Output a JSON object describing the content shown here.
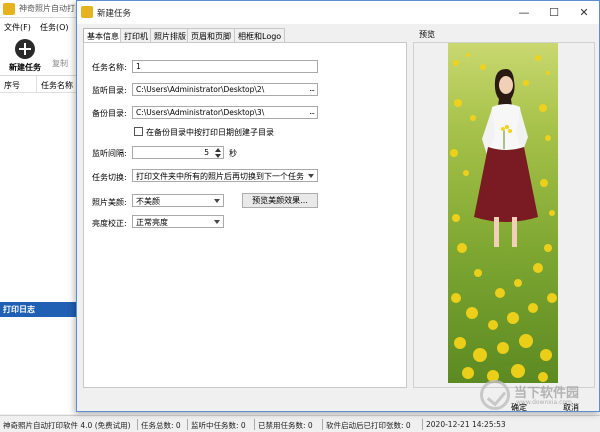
{
  "main_window": {
    "title": "神奇照片自动打",
    "menu": [
      "文件(F)",
      "任务(O)"
    ],
    "toolbar": {
      "new_task": "新建任务",
      "copy": "复制"
    },
    "list_headers": [
      "序号",
      "任务名称"
    ],
    "log_title": "打印日志"
  },
  "statusbar": {
    "items": [
      "神奇照片自动打印软件 4.0 (免费试用)",
      "任务总数: 0",
      "监听中任务数: 0",
      "已禁用任务数: 0",
      "软件启动后已打印张数: 0",
      "2020-12-21  14:25:53"
    ]
  },
  "dialog": {
    "title": "新建任务",
    "window_buttons": {
      "minimize": "—",
      "maximize": "☐",
      "close": "✕"
    },
    "tabs": [
      "基本信息",
      "打印机",
      "照片排版",
      "页眉和页脚",
      "相框和Logo"
    ],
    "active_tab": 0,
    "form": {
      "task_name_label": "任务名称:",
      "task_name_value": "1",
      "watch_dir_label": "监听目录:",
      "watch_dir_value": "C:\\Users\\Administrator\\Desktop\\2\\",
      "backup_dir_label": "备份目录:",
      "backup_dir_value": "C:\\Users\\Administrator\\Desktop\\3\\",
      "browse": "...",
      "date_subdir_checkbox": "在备份目录中按打印日期创建子目录",
      "date_subdir_checked": false,
      "interval_label": "监听间隔:",
      "interval_value": "5",
      "interval_unit": "秒",
      "switch_label": "任务切换:",
      "switch_value": "打印文件夹中所有的照片后再切换到下一个任务",
      "beauty_label": "照片美颜:",
      "beauty_value": "不美颜",
      "preview_beauty_button": "预览美颜效果...",
      "brightness_label": "亮度校正:",
      "brightness_value": "正常亮度"
    },
    "preview_label": "预览",
    "ok_button": "确定",
    "cancel_button": "取消"
  },
  "watermark": {
    "text": "当下软件园",
    "url": "www.downxia.com"
  },
  "colors": {
    "log_header": "#1f5fb4",
    "dialog_border": "#5d8ed0",
    "photo_grass": "#6a9a2a",
    "flower": "#f2d21a"
  }
}
